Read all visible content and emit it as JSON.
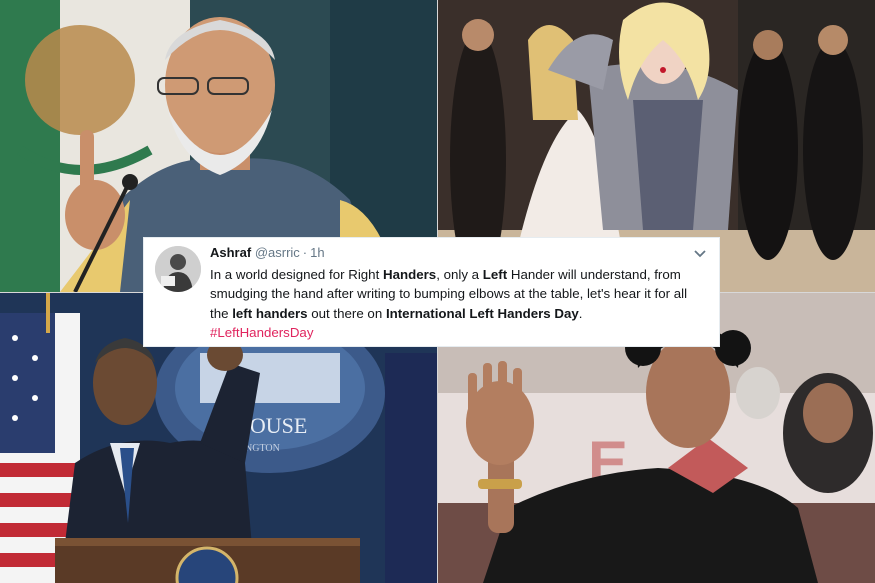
{
  "tweet": {
    "name": "Ashraf",
    "handle": "@asrric",
    "separator": "·",
    "time": "1h",
    "avatar_icon": "user-avatar-icon",
    "menu_icon": "chevron-down-icon",
    "segments": [
      {
        "text": "In a world designed for Right ",
        "bold": false
      },
      {
        "text": "Handers",
        "bold": true
      },
      {
        "text": ", only a ",
        "bold": false
      },
      {
        "text": "Left",
        "bold": true
      },
      {
        "text": " Hander will understand, from smudging the hand after writing to bumping elbows at the table, let's hear it for all the ",
        "bold": false
      },
      {
        "text": "left handers",
        "bold": true
      },
      {
        "text": " out there on ",
        "bold": false
      },
      {
        "text": "International Left Handers Day",
        "bold": true
      },
      {
        "text": ".",
        "bold": false
      }
    ],
    "hashtag": "#LeftHandersDay",
    "hashtag_color": "#e0245e"
  },
  "panels": {
    "obama_sign_text": "E HOUSE",
    "obama_sign_subtext": "NGTON",
    "tendulkar_bg_text": "E"
  }
}
